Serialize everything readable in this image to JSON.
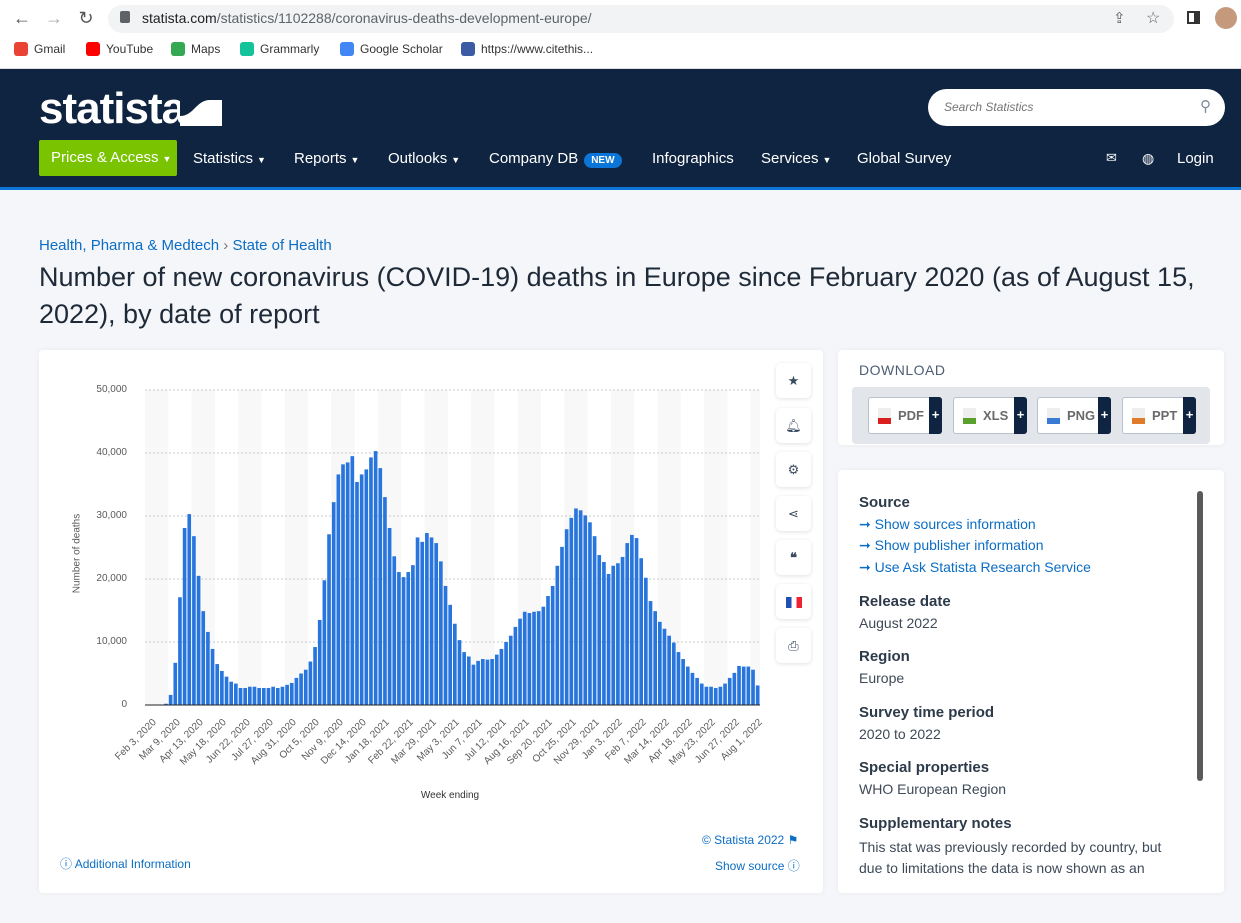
{
  "browser": {
    "url_host": "statista.com",
    "url_path": "/statistics/1102288/coronavirus-deaths-development-europe/",
    "bookmarks": [
      {
        "label": "Gmail",
        "color": "#ea4335"
      },
      {
        "label": "YouTube",
        "color": "#ff0000"
      },
      {
        "label": "Maps",
        "color": "#34a853"
      },
      {
        "label": "Grammarly",
        "color": "#15c39a"
      },
      {
        "label": "Google Scholar",
        "color": "#4285f4"
      },
      {
        "label": "https://www.citethis...",
        "color": "#3b5ba5"
      }
    ]
  },
  "nav": {
    "logo": "statista",
    "search_placeholder": "Search Statistics",
    "prices": "Prices & Access",
    "items": [
      "Statistics",
      "Reports",
      "Outlooks",
      "Company DB",
      "Infographics",
      "Services",
      "Global Survey"
    ],
    "new_badge": "NEW",
    "login": "Login"
  },
  "breadcrumb": {
    "category": "Health, Pharma & Medtech",
    "separator": "›",
    "subcategory": "State of Health"
  },
  "title": "Number of new coronavirus (COVID-19) deaths in Europe since February 2020 (as of August 15, 2022), by date of report",
  "chart_footer": {
    "copyright": "© Statista 2022",
    "additional_info": "Additional Information",
    "show_source": "Show source"
  },
  "download": {
    "title": "DOWNLOAD",
    "formats": [
      {
        "label": "PDF",
        "color": "#d9201f"
      },
      {
        "label": "XLS",
        "color": "#5aa02c"
      },
      {
        "label": "PNG",
        "color": "#3a7bd5"
      },
      {
        "label": "PPT",
        "color": "#e07b2a"
      }
    ],
    "plus": "+"
  },
  "info": {
    "source_h": "Source",
    "links": [
      "Show sources information",
      "Show publisher information",
      "Use Ask Statista Research Service"
    ],
    "release_h": "Release date",
    "release": "August 2022",
    "region_h": "Region",
    "region": "Europe",
    "period_h": "Survey time period",
    "period": "2020 to 2022",
    "special_h": "Special properties",
    "special": "WHO European Region",
    "notes_h": "Supplementary notes",
    "notes": "This stat was previously recorded by country, but due to limitations the data is now shown as an"
  },
  "colors": {
    "bar": "#2876dd",
    "nav_bg": "#0f2440",
    "accent_green": "#79c300",
    "link": "#0b6dc4"
  },
  "chart_data": {
    "type": "bar",
    "xlabel": "Week ending",
    "ylabel": "Number of deaths",
    "ylim": [
      0,
      50000
    ],
    "yticks": [
      0,
      10000,
      20000,
      30000,
      40000,
      50000
    ],
    "ytick_labels": [
      "0",
      "10,000",
      "20,000",
      "30,000",
      "40,000",
      "50,000"
    ],
    "grid": true,
    "xtick_labels": [
      "Feb 3, 2020",
      "Mar 9, 2020",
      "Apr 13, 2020",
      "May 18, 2020",
      "Jun 22, 2020",
      "Jul 27, 2020",
      "Aug 31, 2020",
      "Oct 5, 2020",
      "Nov 9, 2020",
      "Dec 14, 2020",
      "Jan 18, 2021",
      "Feb 22, 2021",
      "Mar 29, 2021",
      "May 3, 2021",
      "Jun 7, 2021",
      "Jul 12, 2021",
      "Aug 16, 2021",
      "Sep 20, 2021",
      "Oct 25, 2021",
      "Nov 29, 2021",
      "Jan 3, 2022",
      "Feb 7, 2022",
      "Mar 14, 2022",
      "Apr 18, 2022",
      "May 23, 2022",
      "Jun 27, 2022",
      "Aug 1, 2022"
    ],
    "categories": [
      "Feb 3, 2020",
      "Feb 10, 2020",
      "Feb 17, 2020",
      "Feb 24, 2020",
      "Mar 2, 2020",
      "Mar 9, 2020",
      "Mar 16, 2020",
      "Mar 23, 2020",
      "Mar 30, 2020",
      "Apr 6, 2020",
      "Apr 13, 2020",
      "Apr 20, 2020",
      "Apr 27, 2020",
      "May 4, 2020",
      "May 11, 2020",
      "May 18, 2020",
      "May 25, 2020",
      "Jun 1, 2020",
      "Jun 8, 2020",
      "Jun 15, 2020",
      "Jun 22, 2020",
      "Jun 29, 2020",
      "Jul 6, 2020",
      "Jul 13, 2020",
      "Jul 20, 2020",
      "Jul 27, 2020",
      "Aug 3, 2020",
      "Aug 10, 2020",
      "Aug 17, 2020",
      "Aug 24, 2020",
      "Aug 31, 2020",
      "Sep 7, 2020",
      "Sep 14, 2020",
      "Sep 21, 2020",
      "Sep 28, 2020",
      "Oct 5, 2020",
      "Oct 12, 2020",
      "Oct 19, 2020",
      "Oct 26, 2020",
      "Nov 2, 2020",
      "Nov 9, 2020",
      "Nov 16, 2020",
      "Nov 23, 2020",
      "Nov 30, 2020",
      "Dec 7, 2020",
      "Dec 14, 2020",
      "Dec 21, 2020",
      "Dec 28, 2020",
      "Jan 4, 2021",
      "Jan 11, 2021",
      "Jan 18, 2021",
      "Jan 25, 2021",
      "Feb 1, 2021",
      "Feb 8, 2021",
      "Feb 15, 2021",
      "Feb 22, 2021",
      "Mar 1, 2021",
      "Mar 8, 2021",
      "Mar 15, 2021",
      "Mar 22, 2021",
      "Mar 29, 2021",
      "Apr 5, 2021",
      "Apr 12, 2021",
      "Apr 19, 2021",
      "Apr 26, 2021",
      "May 3, 2021",
      "May 10, 2021",
      "May 17, 2021",
      "May 24, 2021",
      "May 31, 2021",
      "Jun 7, 2021",
      "Jun 14, 2021",
      "Jun 21, 2021",
      "Jun 28, 2021",
      "Jul 5, 2021",
      "Jul 12, 2021",
      "Jul 19, 2021",
      "Jul 26, 2021",
      "Aug 2, 2021",
      "Aug 9, 2021",
      "Aug 16, 2021",
      "Aug 23, 2021",
      "Aug 30, 2021",
      "Sep 6, 2021",
      "Sep 13, 2021",
      "Sep 20, 2021",
      "Sep 27, 2021",
      "Oct 4, 2021",
      "Oct 11, 2021",
      "Oct 18, 2021",
      "Oct 25, 2021",
      "Nov 1, 2021",
      "Nov 8, 2021",
      "Nov 15, 2021",
      "Nov 22, 2021",
      "Nov 29, 2021",
      "Dec 6, 2021",
      "Dec 13, 2021",
      "Dec 20, 2021",
      "Dec 27, 2021",
      "Jan 3, 2022",
      "Jan 10, 2022",
      "Jan 17, 2022",
      "Jan 24, 2022",
      "Jan 31, 2022",
      "Feb 7, 2022",
      "Feb 14, 2022",
      "Feb 21, 2022",
      "Feb 28, 2022",
      "Mar 7, 2022",
      "Mar 14, 2022",
      "Mar 21, 2022",
      "Mar 28, 2022",
      "Apr 4, 2022",
      "Apr 11, 2022",
      "Apr 18, 2022",
      "Apr 25, 2022",
      "May 2, 2022",
      "May 9, 2022",
      "May 16, 2022",
      "May 23, 2022",
      "May 30, 2022",
      "Jun 6, 2022",
      "Jun 13, 2022",
      "Jun 20, 2022",
      "Jun 27, 2022",
      "Jul 4, 2022",
      "Jul 11, 2022",
      "Jul 18, 2022",
      "Jul 25, 2022",
      "Aug 1, 2022",
      "Aug 8, 2022"
    ],
    "values": [
      0,
      0,
      0,
      0,
      200,
      1600,
      6700,
      17100,
      28100,
      30300,
      26800,
      20500,
      14900,
      11600,
      8900,
      6500,
      5400,
      4500,
      3700,
      3400,
      2700,
      2700,
      2900,
      2900,
      2700,
      2700,
      2700,
      2900,
      2700,
      2900,
      3200,
      3500,
      4300,
      5000,
      5600,
      6900,
      9200,
      13500,
      19800,
      27100,
      32200,
      36600,
      38200,
      38500,
      39500,
      35400,
      36600,
      37400,
      39300,
      40300,
      37600,
      33000,
      28100,
      23600,
      21100,
      20300,
      21100,
      22200,
      26600,
      25900,
      27300,
      26600,
      25700,
      22800,
      18900,
      15900,
      12900,
      10300,
      8400,
      7700,
      6400,
      7000,
      7300,
      7200,
      7300,
      8000,
      8900,
      10000,
      11000,
      12400,
      13700,
      14800,
      14600,
      14800,
      14900,
      15600,
      17300,
      18900,
      22100,
      25100,
      27900,
      29700,
      31200,
      30900,
      30100,
      29000,
      26800,
      23800,
      22700,
      20800,
      22100,
      22500,
      23500,
      25700,
      27000,
      26500,
      23300,
      20200,
      16500,
      14900,
      13200,
      12100,
      11000,
      9900,
      8400,
      7300,
      6100,
      5100,
      4300,
      3400,
      2900,
      2900,
      2700,
      2900,
      3400,
      4300,
      5100,
      6200,
      6100,
      6100,
      5600,
      3100
    ]
  }
}
